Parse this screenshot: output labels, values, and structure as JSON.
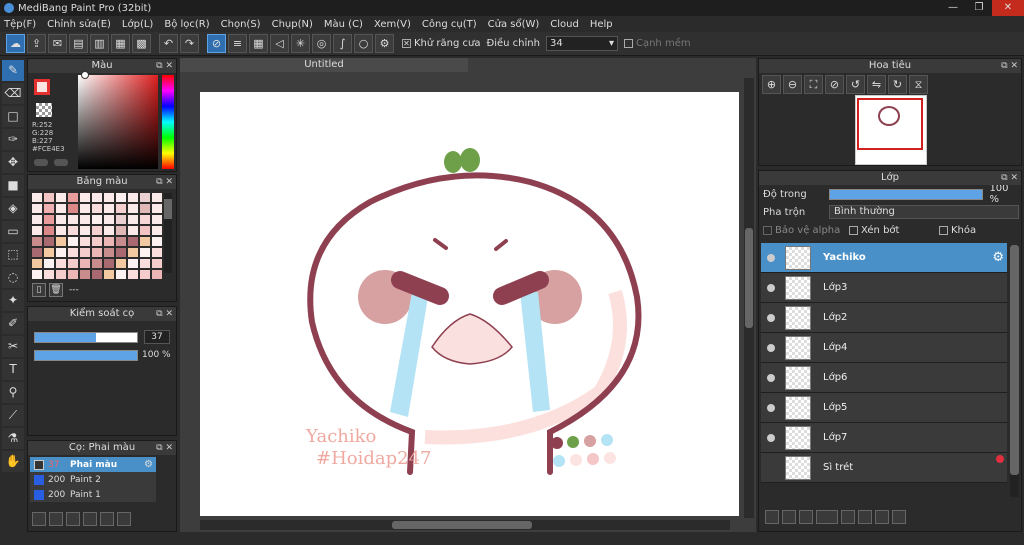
{
  "window": {
    "title": "MediBang Paint Pro (32bit)",
    "minimize": "—",
    "maximize": "❐",
    "close": "✕"
  },
  "menu": [
    "Tệp(F)",
    "Chỉnh sửa(E)",
    "Lớp(L)",
    "Bộ lọc(R)",
    "Chọn(S)",
    "Chụp(N)",
    "Màu (C)",
    "Xem(V)",
    "Công cụ(T)",
    "Cửa sổ(W)",
    "Cloud",
    "Help"
  ],
  "toolbar": {
    "antialias_label": "Khử răng cưa",
    "adjust_label": "Điều chỉnh",
    "adjust_value": "34",
    "edge_label": "Cạnh mềm"
  },
  "color_panel": {
    "title": "Màu",
    "r": "R:252",
    "g": "G:228",
    "b": "B:227",
    "hex": "#FCE4E3",
    "fg": "#FCE4E3",
    "accent": "#e53030"
  },
  "palette_panel": {
    "title": "Bảng màu",
    "footer": "---"
  },
  "brush_control": {
    "title": "Kiểm soát cọ",
    "size": "37",
    "size_fraction": 0.6,
    "opacity": "100 %",
    "opacity_fraction": 1.0
  },
  "brush_list": {
    "title": "Cọ: Phai màu",
    "items": [
      {
        "size": "37",
        "name": "Phai màu",
        "active": true
      },
      {
        "size": "200",
        "name": "Paint 2",
        "active": false
      },
      {
        "size": "200",
        "name": "Paint 1",
        "active": false
      }
    ]
  },
  "canvas": {
    "tab": "Untitled",
    "text1": "Yachiko",
    "text2": "#Hoidap247"
  },
  "navigator": {
    "title": "Hoa tiêu"
  },
  "layers": {
    "title": "Lớp",
    "opacity_label": "Độ trong",
    "opacity_value": "100 %",
    "opacity_fraction": 1.0,
    "blend_label": "Pha trộn",
    "blend_value": "Bình thường",
    "protect_alpha": "Bảo vệ alpha",
    "clip": "Xén bớt",
    "lock": "Khóa",
    "items": [
      {
        "name": "Yachiko",
        "active": true
      },
      {
        "name": "Lớp3",
        "active": false
      },
      {
        "name": "Lớp2",
        "active": false
      },
      {
        "name": "Lớp4",
        "active": false
      },
      {
        "name": "Lớp6",
        "active": false
      },
      {
        "name": "Lớp5",
        "active": false
      },
      {
        "name": "Lớp7",
        "active": false
      },
      {
        "name": "Sì trét",
        "active": false
      }
    ]
  }
}
